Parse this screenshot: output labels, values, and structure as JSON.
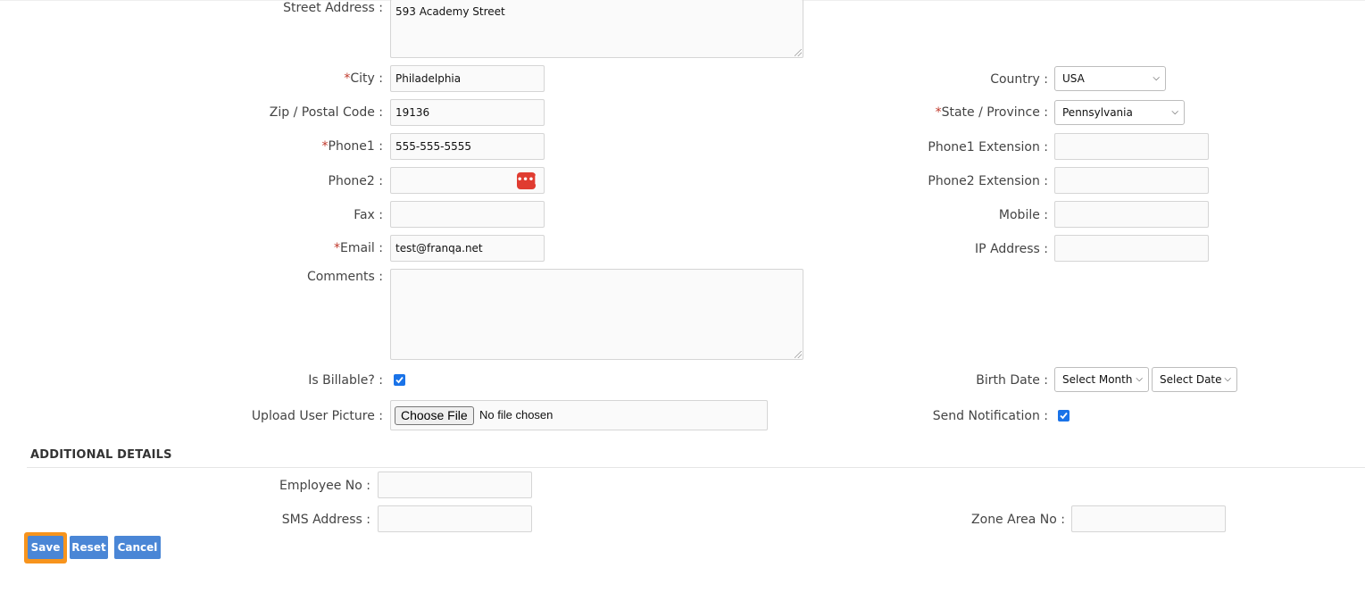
{
  "form": {
    "street_address": {
      "label": "Street Address :",
      "value": "593 Academy Street"
    },
    "city": {
      "required": "*",
      "label": "City :",
      "value": "Philadelphia"
    },
    "country": {
      "label": "Country :",
      "value": "USA"
    },
    "zip": {
      "label": "Zip / Postal Code :",
      "value": "19136"
    },
    "state": {
      "required": "*",
      "label": "State / Province :",
      "value": "Pennsylvania"
    },
    "phone1": {
      "required": "*",
      "label": "Phone1 :",
      "value": "555-555-5555"
    },
    "phone1_ext": {
      "label": "Phone1 Extension :",
      "value": ""
    },
    "phone2": {
      "label": "Phone2 :",
      "value": "",
      "icon": "password-manager-icon",
      "icon_glyph": "•••|"
    },
    "phone2_ext": {
      "label": "Phone2 Extension :",
      "value": ""
    },
    "fax": {
      "label": "Fax :",
      "value": ""
    },
    "mobile": {
      "label": "Mobile :",
      "value": ""
    },
    "email": {
      "required": "*",
      "label": "Email :",
      "value": "test@franqa.net"
    },
    "ip_address": {
      "label": "IP Address :",
      "value": ""
    },
    "comments": {
      "label": "Comments :",
      "value": ""
    },
    "is_billable": {
      "label": "Is Billable? :",
      "checked": true
    },
    "birth_date": {
      "label": "Birth Date :",
      "month": "Select Month",
      "date": "Select Date"
    },
    "upload_picture": {
      "label": "Upload User Picture :",
      "button": "Choose File",
      "status": "No file chosen"
    },
    "send_notification": {
      "label": "Send Notification :",
      "checked": true
    }
  },
  "additional": {
    "title": "ADDITIONAL DETAILS",
    "employee_no": {
      "label": "Employee No :",
      "value": ""
    },
    "sms_address": {
      "label": "SMS Address :",
      "value": ""
    },
    "zone_area_no": {
      "label": "Zone Area No :",
      "value": ""
    }
  },
  "actions": {
    "save": "Save",
    "reset": "Reset",
    "cancel": "Cancel"
  },
  "colors": {
    "required": "#c0392b",
    "button": "#4a86d6",
    "focus_ring": "#f7941d",
    "checkbox": "#1a73e8",
    "password_icon": "#e03c31"
  }
}
